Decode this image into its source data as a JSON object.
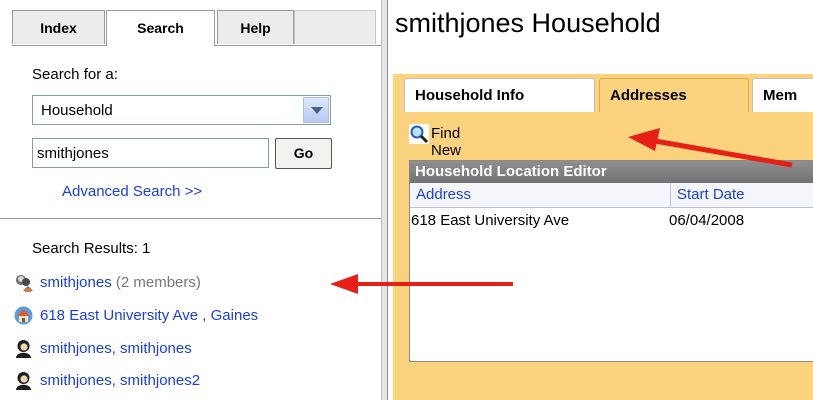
{
  "left_panel": {
    "tabs": [
      {
        "label": "Index"
      },
      {
        "label": "Search"
      },
      {
        "label": "Help"
      }
    ],
    "search_for_label": "Search for a:",
    "search_type": {
      "selected": "Household"
    },
    "search_query": {
      "value": "smithjones"
    },
    "go_label": "Go",
    "advanced_search_label": "Advanced Search >>",
    "results_label": "Search Results: 1",
    "results": [
      {
        "text": "smithjones",
        "extra": "(2 members)",
        "icon": "household-group-icon"
      },
      {
        "text": "618 East University Ave , Gaines",
        "icon": "house-icon"
      },
      {
        "text": "smithjones, smithjones",
        "icon": "person-icon"
      },
      {
        "text": "smithjones, smithjones2",
        "icon": "person-icon"
      }
    ]
  },
  "right_panel": {
    "title": "smithjones Household",
    "tabs": [
      {
        "label": "Household Info"
      },
      {
        "label": "Addresses"
      },
      {
        "label": "Mem"
      }
    ],
    "find_new_address_label": "Find New Address",
    "grid": {
      "title": "Household Location Editor",
      "columns": [
        "Address",
        "Start Date"
      ],
      "rows": [
        [
          "618 East University Ave",
          "06/04/2008"
        ]
      ]
    }
  },
  "colors": {
    "panel_accent": "#fbd27e",
    "link": "#1a3fdc",
    "annotation_arrow": "#e61f17"
  }
}
